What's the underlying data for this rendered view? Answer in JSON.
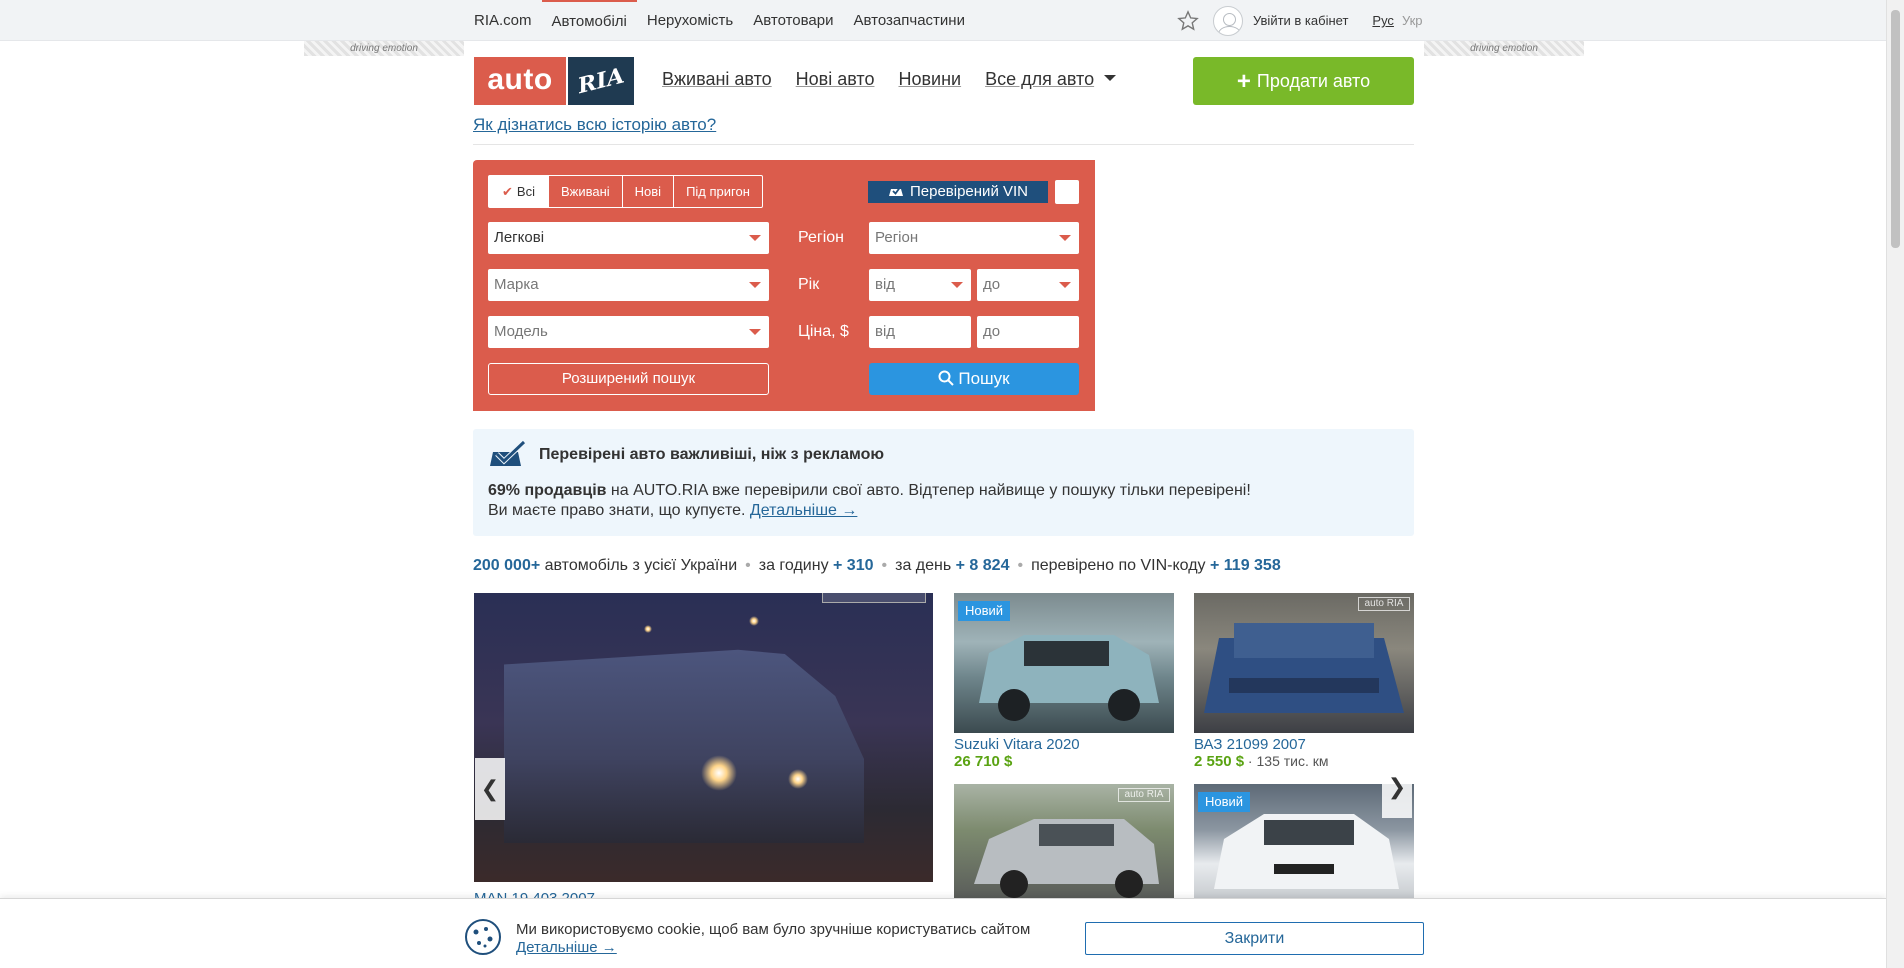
{
  "topbar": {
    "links": [
      "RIA.com",
      "Автомобілі",
      "Нерухомість",
      "Автотовари",
      "Автозапчастини"
    ],
    "login": "Увійти в кабінет",
    "lang_ru": "Рус",
    "lang_ua": "Укр"
  },
  "side_banner": "driving emotion",
  "logo": {
    "left": "auto",
    "right": "RIA"
  },
  "nav": {
    "used": "Вживані авто",
    "new": "Нові авто",
    "news": "Новини",
    "all": "Все для авто"
  },
  "sell_button": "Продати авто",
  "history_link": "Як дізнатись всю історію авто?",
  "search": {
    "tabs": [
      "Всі",
      "Вживані",
      "Нові",
      "Під пригон"
    ],
    "vin_button": "Перевірений VIN",
    "type_value": "Легкові",
    "brand_placeholder": "Марка",
    "model_placeholder": "Модель",
    "region_label": "Регіон",
    "region_placeholder": "Регіон",
    "year_label": "Рік",
    "year_from": "від",
    "year_to": "до",
    "price_label": "Ціна, $",
    "price_from": "від",
    "price_to": "до",
    "advanced": "Розширений пошук",
    "submit": "Пошук"
  },
  "info": {
    "title": "Перевірені авто важливіші, ніж з рекламою",
    "p1_bold": "69% продавців",
    "p1_rest": " на AUTO.RIA вже перевірили свої авто. Відтепер найвище у пошуку тільки перевірені!",
    "p2": "Ви маєте право знати, що купуєте.",
    "p2_link": "Детальніше →"
  },
  "stats": {
    "total": "200 000+",
    "total_label": " автомобіль з усієї України",
    "hour_label": "за годину ",
    "hour": "+ 310",
    "day_label": "за день ",
    "day": "+ 8 824",
    "vin_label": "перевірено по VIN-коду ",
    "vin": "+ 119 358"
  },
  "featured_caption": "MAN 19.403 2007",
  "listings": [
    {
      "badge": "Новий",
      "title": "Suzuki Vitara 2020",
      "price": "26 710 $",
      "mileage": ""
    },
    {
      "badge": "",
      "title": "ВАЗ 21099 2007",
      "price": "2 550 $",
      "mileage": "135 тис. км"
    },
    {
      "badge": "",
      "title": "",
      "price": "",
      "mileage": ""
    },
    {
      "badge": "Новий",
      "title": "",
      "price": "",
      "mileage": ""
    }
  ],
  "watermark": "auto RIA",
  "cookie": {
    "text": "Ми використовуємо cookie, щоб вам було зручніше користуватись сайтом",
    "more": "Детальніше →",
    "close": "Закрити"
  },
  "colors": {
    "brand_red": "#db5c4c",
    "brand_navy": "#1f3a51",
    "green": "#79b929",
    "link": "#256799",
    "blue_btn": "#2b95e0"
  }
}
